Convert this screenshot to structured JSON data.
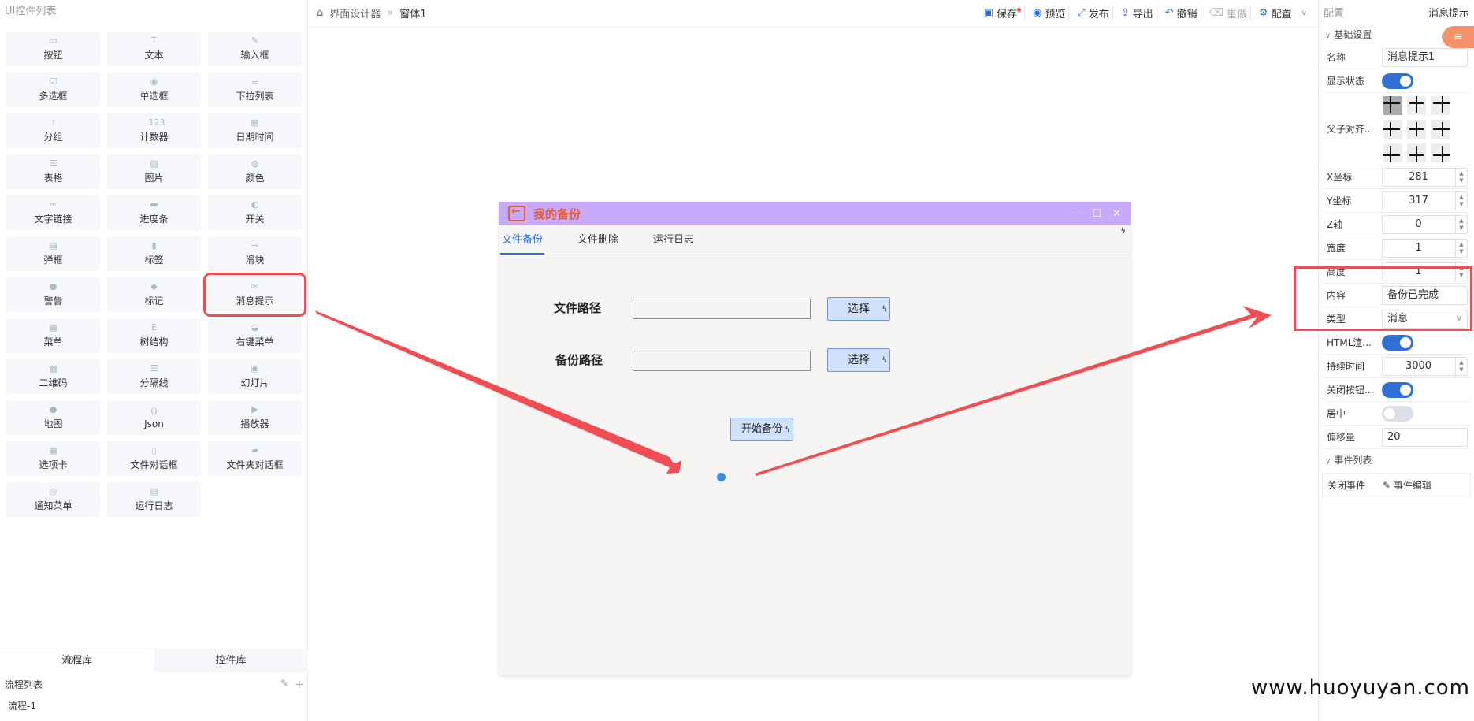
{
  "left": {
    "title": "UI控件列表",
    "items": [
      {
        "label": "按钮",
        "icon": "▭"
      },
      {
        "label": "文本",
        "icon": "T"
      },
      {
        "label": "输入框",
        "icon": "✎"
      },
      {
        "label": "多选框",
        "icon": "☑"
      },
      {
        "label": "单选框",
        "icon": "◉"
      },
      {
        "label": "下拉列表",
        "icon": "≡"
      },
      {
        "label": "分组",
        "icon": "⁝"
      },
      {
        "label": "计数器",
        "icon": "123"
      },
      {
        "label": "日期时间",
        "icon": "▦"
      },
      {
        "label": "表格",
        "icon": "☰"
      },
      {
        "label": "图片",
        "icon": "▨"
      },
      {
        "label": "颜色",
        "icon": "◍"
      },
      {
        "label": "文字链接",
        "icon": "∞"
      },
      {
        "label": "进度条",
        "icon": "▬"
      },
      {
        "label": "开关",
        "icon": "◐"
      },
      {
        "label": "弹框",
        "icon": "▤"
      },
      {
        "label": "标签",
        "icon": "▮"
      },
      {
        "label": "滑块",
        "icon": "⊸"
      },
      {
        "label": "警告",
        "icon": "●"
      },
      {
        "label": "标记",
        "icon": "◆"
      },
      {
        "label": "消息提示",
        "icon": "✉"
      },
      {
        "label": "菜单",
        "icon": "▦"
      },
      {
        "label": "树结构",
        "icon": "E"
      },
      {
        "label": "右键菜单",
        "icon": "◒"
      },
      {
        "label": "二维码",
        "icon": "▩"
      },
      {
        "label": "分隔线",
        "icon": "☰"
      },
      {
        "label": "幻灯片",
        "icon": "▣"
      },
      {
        "label": "地图",
        "icon": "●"
      },
      {
        "label": "Json",
        "icon": "()"
      },
      {
        "label": "播放器",
        "icon": "▶"
      },
      {
        "label": "选项卡",
        "icon": "▦"
      },
      {
        "label": "文件对话框",
        "icon": "▯"
      },
      {
        "label": "文件夹对话框",
        "icon": "▰"
      },
      {
        "label": "通知菜单",
        "icon": "◎"
      },
      {
        "label": "运行日志",
        "icon": "▤"
      }
    ],
    "lib_tabs": [
      "流程库",
      "控件库"
    ],
    "flow_list_title": "流程列表",
    "flow_items": [
      "流程-1"
    ]
  },
  "topbar": {
    "breadcrumb": [
      "界面设计器",
      "窗体1"
    ],
    "tools": [
      {
        "label": "保存",
        "icon": "floppy-icon"
      },
      {
        "label": "预览",
        "icon": "eye-icon"
      },
      {
        "label": "发布",
        "icon": "publish-icon"
      },
      {
        "label": "导出",
        "icon": "export-icon"
      },
      {
        "label": "撤销",
        "icon": "undo-icon"
      },
      {
        "label": "重做",
        "icon": "redo-icon"
      },
      {
        "label": "配置",
        "icon": "gear-icon"
      }
    ]
  },
  "window": {
    "title": "我的备份",
    "tabs": [
      "文件备份",
      "文件删除",
      "运行日志"
    ],
    "file_path_label": "文件路径",
    "backup_path_label": "备份路径",
    "select_label": "选择",
    "start_label": "开始备份"
  },
  "right": {
    "header_left": "配置",
    "header_right": "消息提示",
    "basic_section": "基础设置",
    "props": {
      "name_k": "名称",
      "name_v": "消息提示1",
      "show_k": "显示状态",
      "align_k": "父子对齐...",
      "x_k": "X坐标",
      "x_v": "281",
      "y_k": "Y坐标",
      "y_v": "317",
      "z_k": "Z轴",
      "z_v": "0",
      "w_k": "宽度",
      "w_v": "1",
      "h_k": "高度",
      "h_v": "1",
      "content_k": "内容",
      "content_v": "备份已完成",
      "type_k": "类型",
      "type_v": "消息",
      "html_k": "HTML渲...",
      "dur_k": "持续时间",
      "dur_v": "3000",
      "close_k": "关闭按钮...",
      "center_k": "居中",
      "offset_k": "偏移量",
      "offset_v": "20"
    },
    "event_section": "事件列表",
    "event_k": "关闭事件",
    "event_v": "事件编辑"
  },
  "watermark": "www.huoyuyan.com",
  "colors": {
    "accent": "#2f6fd6",
    "title_bar": "#c8a9fb",
    "title_text": "#e55b2c",
    "highlight": "#f04e52"
  }
}
